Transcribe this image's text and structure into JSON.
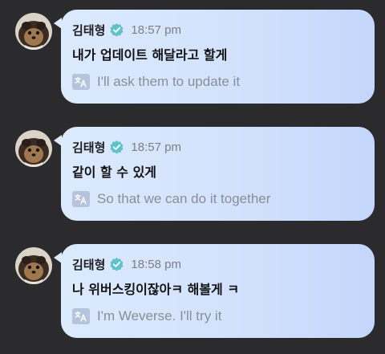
{
  "colors": {
    "background": "#2b2b2d",
    "bubble": "#d2e2fd",
    "verified": "#5fc2c9",
    "muted_text": "#8a8e96"
  },
  "messages": [
    {
      "sender": "김태형",
      "time": "18:57 pm",
      "text": "내가 업데이트 해달라고 할게",
      "translation": "I'll ask them to update it",
      "avatar_icon": "profile-photo",
      "badge_icon": "verified-check-icon",
      "translate_icon": "translate-icon"
    },
    {
      "sender": "김태형",
      "time": "18:57 pm",
      "text": "같이 할 수 있게",
      "translation": "So that we can do it together",
      "avatar_icon": "profile-photo",
      "badge_icon": "verified-check-icon",
      "translate_icon": "translate-icon"
    },
    {
      "sender": "김태형",
      "time": "18:58 pm",
      "text": "나 위버스킹이잖아ㅋ 해볼게 ㅋ",
      "translation": "I'm Weverse. I'll try it",
      "avatar_icon": "profile-photo",
      "badge_icon": "verified-check-icon",
      "translate_icon": "translate-icon"
    }
  ]
}
